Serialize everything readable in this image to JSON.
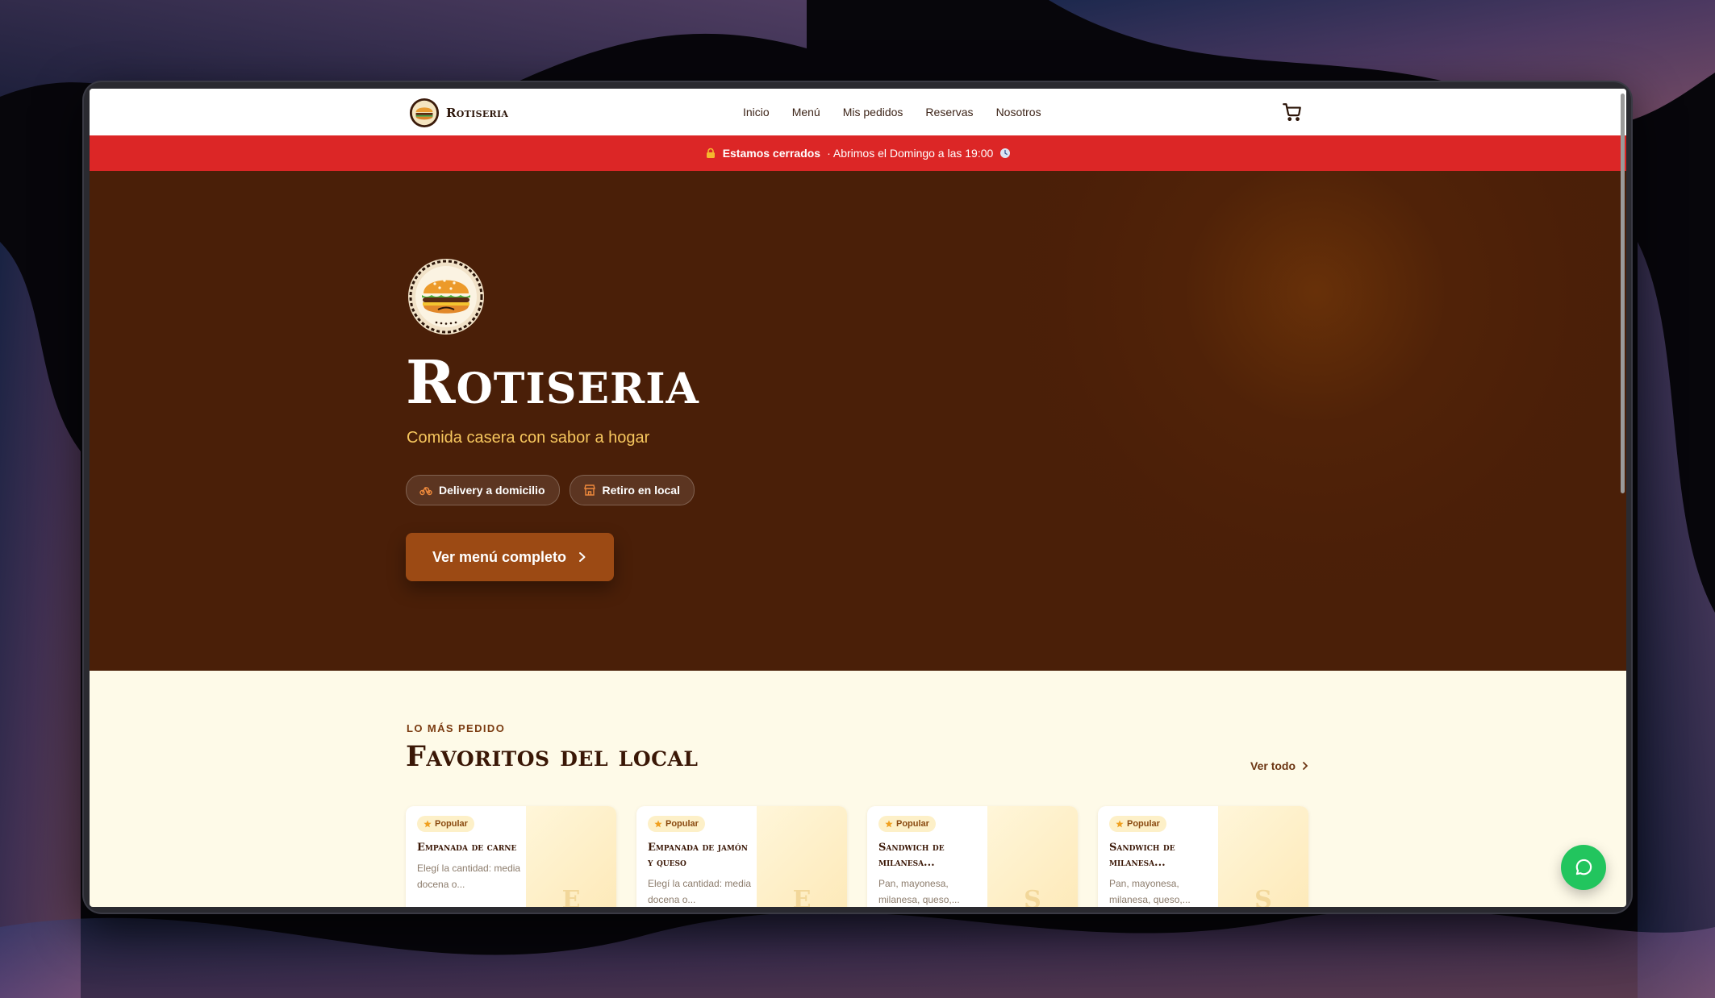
{
  "brand": {
    "name": "Rotiseria"
  },
  "nav": {
    "items": [
      "Inicio",
      "Menú",
      "Mis pedidos",
      "Reservas",
      "Nosotros"
    ]
  },
  "status_banner": {
    "closed_label": "Estamos cerrados",
    "next_open": "· Abrimos el Domingo a las 19:00",
    "color": "#dc2626"
  },
  "hero": {
    "title": "Rotiseria",
    "subtitle": "Comida casera con sabor a hogar",
    "pills": [
      "Delivery a domicilio",
      "Retiro en local"
    ],
    "cta_label": "Ver menú completo",
    "background": "#4a1f08",
    "accent": "#9c4a14"
  },
  "favorites": {
    "eyebrow": "LO MÁS PEDIDO",
    "title": "Favoritos del local",
    "see_all": "Ver todo",
    "badge": "Popular",
    "cards": [
      {
        "name": "Empanada de carne",
        "desc": "Elegí la cantidad: media docena o...",
        "letter": "E"
      },
      {
        "name": "Empanada de jamón y queso",
        "desc": "Elegí la cantidad: media docena o...",
        "letter": "E"
      },
      {
        "name": "Sandwich de milanesa...",
        "desc": "Pan, mayonesa, milanesa, queso,...",
        "letter": "S"
      },
      {
        "name": "Sandwich de milanesa...",
        "desc": "Pan, mayonesa, milanesa, queso,...",
        "letter": "S"
      }
    ]
  },
  "icons": {
    "cart": "cart-icon",
    "whatsapp": "chat-bubble-icon",
    "lock": "lock-icon",
    "clock": "clock-icon",
    "bike": "bike-icon",
    "store": "store-icon",
    "star": "star-icon",
    "chevron": "chevron-right-icon"
  },
  "colors": {
    "page_bg": "#fefae8",
    "whatsapp": "#22c55e"
  }
}
